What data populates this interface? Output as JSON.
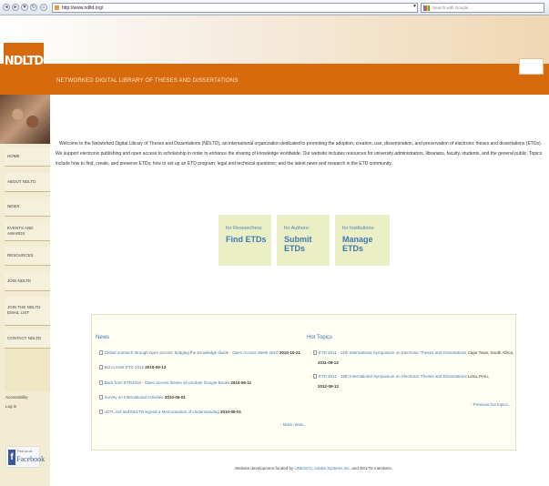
{
  "browser": {
    "url": "http://www.ndltd.org/",
    "search_placeholder": "Search with Google",
    "back_glyph": "◄",
    "forward_glyph": "►",
    "reload_glyph": "↻",
    "home_glyph": "⌂",
    "dropdown_glyph": "▼"
  },
  "header": {
    "logo_text": "NDLTD",
    "site_title": "NETWORKED DIGITAL LIBRARY OF THESES AND DISSERTATIONS"
  },
  "sidebar": {
    "items": [
      {
        "label": "HOME"
      },
      {
        "label": "ABOUT NDLTD"
      },
      {
        "label": "NEWS"
      },
      {
        "label": "EVENTS AND AWARDS"
      },
      {
        "label": "RESOURCES"
      },
      {
        "label": "JOIN NDLTD"
      },
      {
        "label": "JOIN THE NDLTD EMAIL LIST"
      },
      {
        "label": "CONTACT NDLTD"
      }
    ],
    "accessibility": "Accessibility",
    "login": "Log in",
    "facebook_find": "Find us on",
    "facebook_name": "Facebook"
  },
  "welcome_text": "Welcome to the Networked Digital Library of Theses and Dissertations (NDLTD), an international organization dedicated to promoting the adoption, creation, use, dissemination, and preservation of electronic theses and dissertations (ETDs). We support electronic publishing and open access to scholarship in order to enhance the sharing of knowledge worldwide. Our website includes resources for university administrators, librarians, faculty, students, and the general public. Topics include how to find, create, and preserve ETDs; how to set up an ETD program; legal and technical questions; and the latest news and research in the ETD community.",
  "cta": [
    {
      "label": "for Researchers:",
      "title": "Find ETDs"
    },
    {
      "label": "for Authors:",
      "title": "Submit ETDs"
    },
    {
      "label": "for Institutions:",
      "title": "Manage ETDs"
    }
  ],
  "news": {
    "title": "News",
    "items": [
      {
        "text": "Global outreach through open access: bridging the knowledge divide - Open Access Week 2010",
        "date": "2010-10-21"
      },
      {
        "text": "Bid to Host ETD 2012",
        "date": "2010-09-13"
      },
      {
        "text": "Back from ETD2010 - Open access theses do predate Google Books",
        "date": "2010-06-11"
      },
      {
        "text": "Survey on International Activities",
        "date": "2010-05-01"
      },
      {
        "text": "uOTL.net and NDLTD signed a Memorandum of Understanding",
        "date": "2010-05-01"
      }
    ],
    "more": "More news..."
  },
  "hot_topics": {
    "title": "Hot Topics",
    "items": [
      {
        "text": "ETD 2011 - 14th International Symposium on Electronic Theses and Dissertations",
        "place": "Cape Town, South Africa,",
        "date": "2011-09-13"
      },
      {
        "text": "ETD 2012 - 15th International Symposium on Electronic Theses and Dissertations",
        "place": "Lima, Peru,",
        "date": "2012-09-12"
      }
    ],
    "previous": "Previous hot topics..."
  },
  "footer": {
    "prefix": "Website development funded by",
    "unesco": "UNESCO",
    "adobe": "Adobe Systems Inc.",
    "suffix": "and NDLTD members."
  }
}
